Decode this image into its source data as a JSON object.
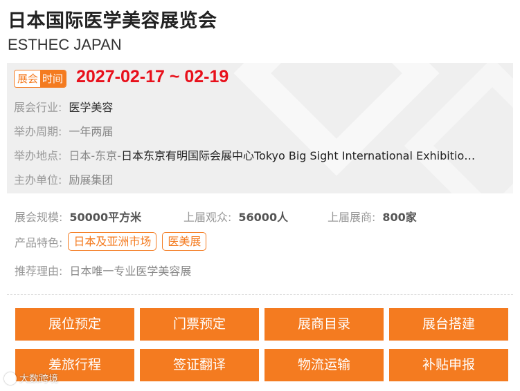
{
  "header": {
    "title_cn": "日本国际医学美容展览会",
    "title_en": "ESTHEC JAPAN"
  },
  "schedule": {
    "badge_part1": "展会",
    "badge_part2": "时间",
    "date_range": "2027-02-17 ~ 02-19"
  },
  "info": {
    "industry_label": "展会行业:",
    "industry_value": "医学美容",
    "cycle_label": "举办周期:",
    "cycle_value": "一年两届",
    "location_label": "举办地点:",
    "location_region": "日本-东京-",
    "location_venue": "日本东京有明国际会展中心Tokyo Big Sight International Exhibitio…",
    "organizer_label": "主办单位:",
    "organizer_value": "励展集团"
  },
  "stats": {
    "scale_label": "展会规模:",
    "scale_value": "50000平方米",
    "visitors_label": "上届观众:",
    "visitors_value": "56000人",
    "exhibitors_label": "上届展商:",
    "exhibitors_value": "800家"
  },
  "features": {
    "label": "产品特色:",
    "tags": [
      "日本及亚洲市场",
      "医美展"
    ]
  },
  "recommend": {
    "label": "推荐理由:",
    "value": "日本唯一专业医学美容展"
  },
  "actions": [
    "展位预定",
    "门票预定",
    "展商目录",
    "展台搭建",
    "差旅行程",
    "签证翻译",
    "物流运输",
    "补贴申报"
  ],
  "watermark": {
    "text": "大数跨境",
    "logo_icon": "watermark-logo-icon"
  },
  "colors": {
    "accent": "#f47b20",
    "date_red": "#e8101b",
    "panel_bg": "#efefef"
  }
}
